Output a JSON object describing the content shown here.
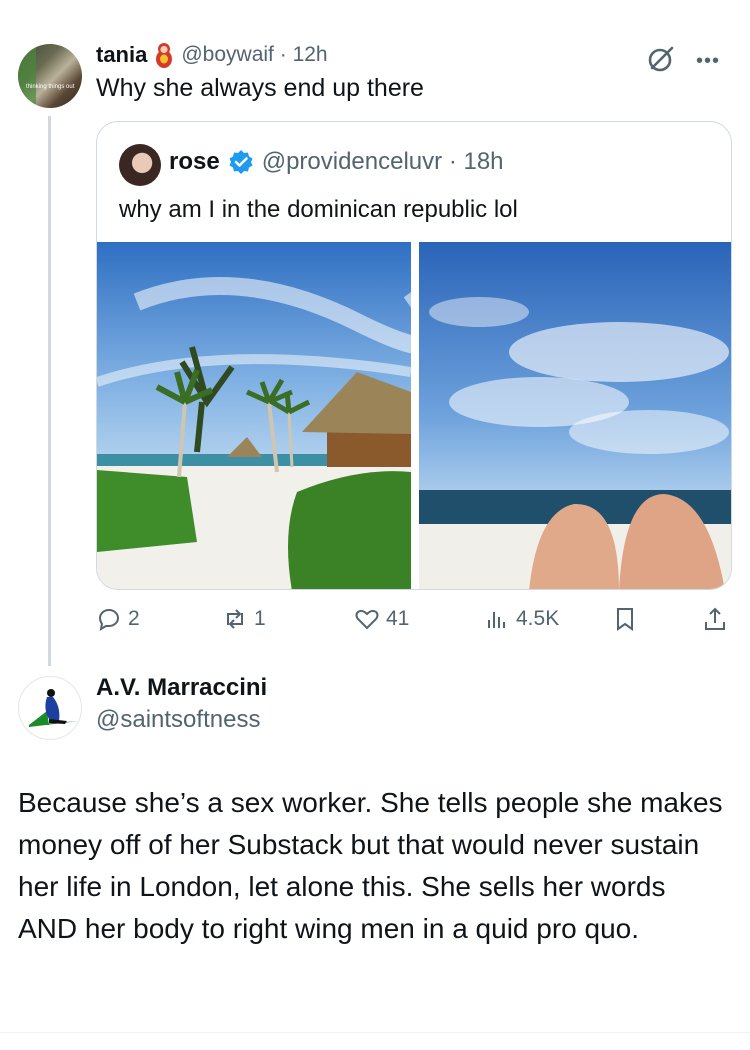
{
  "tweet": {
    "author_name": "tania",
    "author_handle": "@boywaif",
    "time": "12h",
    "text": "Why she always end up there",
    "avatar_caption": "thinking things out"
  },
  "quoted": {
    "author_name": "rose",
    "author_handle": "@providenceluvr",
    "time": "18h",
    "text": "why am I in the dominican republic lol",
    "photos": [
      "beach-palms-cabana",
      "legs-on-beach-sky"
    ]
  },
  "actions": {
    "replies": "2",
    "reposts": "1",
    "likes": "41",
    "views": "4.5K"
  },
  "reply": {
    "author_name": "A.V. Marraccini",
    "author_handle": "@saintsoftness",
    "text": "Because she’s a sex worker. She tells people she makes money off of her Substack but that would never sustain her life in London, let alone this. She sells her words AND her body to right wing men in a quid pro quo."
  },
  "icons": {
    "grok": "grok-icon",
    "more": "more-icon",
    "reply": "reply-icon",
    "repost": "repost-icon",
    "like": "heart-icon",
    "views": "views-icon",
    "bookmark": "bookmark-icon",
    "share": "share-icon"
  },
  "colors": {
    "text": "#0f1419",
    "secondary": "#536471",
    "border": "#cfd9de",
    "verified": "#1d9bf0"
  }
}
